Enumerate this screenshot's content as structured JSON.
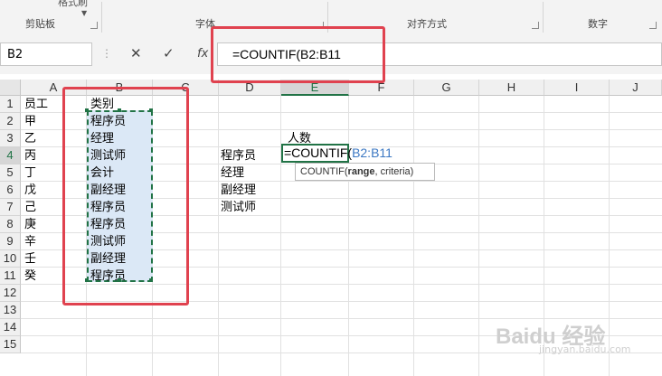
{
  "ribbon": {
    "clipboard_label": "剪贴板",
    "format_painter_label": "格式刷",
    "font_label": "字体",
    "alignment_label": "对齐方式",
    "number_label": "数字"
  },
  "formula_bar": {
    "name_box": "B2",
    "formula": "=COUNTIF(B2:B11",
    "cancel_icon": "close-icon",
    "enter_icon": "check-icon",
    "fx_label": "fx"
  },
  "columns": [
    "A",
    "B",
    "C",
    "D",
    "E",
    "F",
    "G",
    "H",
    "I",
    "J"
  ],
  "rows": [
    "1",
    "2",
    "3",
    "4",
    "5",
    "6",
    "7",
    "8",
    "9",
    "10",
    "11",
    "12",
    "13",
    "14",
    "15"
  ],
  "sheet": {
    "colA": [
      "员工",
      "甲",
      "乙",
      "丙",
      "丁",
      "戊",
      "己",
      "庚",
      "辛",
      "壬",
      "癸"
    ],
    "colB": [
      "类别",
      "程序员",
      "经理",
      "测试师",
      "会计",
      "副经理",
      "程序员",
      "程序员",
      "测试师",
      "副经理",
      "程序员"
    ],
    "colD": [
      "程序员",
      "经理",
      "副经理",
      "测试师"
    ],
    "E3": "人数"
  },
  "edit": {
    "prefix": "=COUNTIF(",
    "ref": "B2:B11"
  },
  "tooltip": {
    "func": "COUNTIF(",
    "arg1": "range",
    "rest": ", criteria)"
  },
  "watermark": {
    "text": "Baidu 经验",
    "sub": "jingyan.baidu.com"
  },
  "colors": {
    "accent": "#217346",
    "highlight": "#e0424f",
    "ref_blue": "#3c78c3"
  }
}
